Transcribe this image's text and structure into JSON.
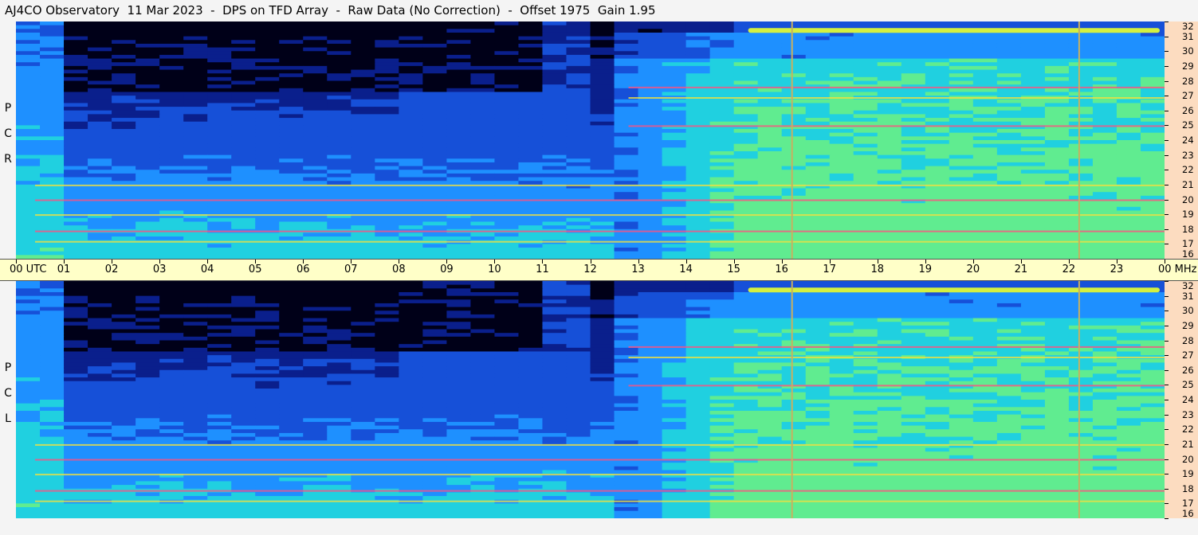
{
  "title": "AJ4CO Observatory  11 Mar 2023  -  DPS on TFD Array  -  Raw Data (No Correction)  -  Offset 1975  Gain 1.95",
  "chart_data": {
    "type": "heatmap",
    "title": "AJ4CO Observatory  11 Mar 2023  -  DPS on TFD Array  -  Raw Data (No Correction)  -  Offset 1975  Gain 1.95",
    "x_axis": {
      "label": "UTC",
      "range": [
        0,
        24
      ],
      "tick_labels": [
        "00",
        "01",
        "02",
        "03",
        "04",
        "05",
        "06",
        "07",
        "08",
        "09",
        "10",
        "11",
        "12",
        "13",
        "14",
        "15",
        "16",
        "17",
        "18",
        "19",
        "20",
        "21",
        "22",
        "23",
        "00"
      ],
      "first_extra": "UTC",
      "last_extra": "MHz"
    },
    "y_axis": {
      "label": "MHz",
      "range": [
        16,
        32
      ],
      "tick_labels": [
        "32",
        "31",
        "30",
        "29",
        "28",
        "27",
        "26",
        "25",
        "24",
        "23",
        "22",
        "21",
        "20",
        "19",
        "18",
        "17",
        "16"
      ]
    },
    "panels": [
      {
        "name": "R C P",
        "letters": [
          "P",
          "C",
          "R"
        ]
      },
      {
        "name": "L C P",
        "letters": [
          "P",
          "C",
          "L"
        ]
      }
    ],
    "colormap": [
      "#000018",
      "#0a1f8c",
      "#1650d8",
      "#1e90ff",
      "#20d0e0",
      "#60ec90",
      "#d4f040",
      "#ff9030",
      "#ff3070"
    ],
    "features": {
      "night_minimum_hours": [
        1,
        12.5
      ],
      "daytime_bright_hours": [
        12.5,
        24
      ],
      "vertical_lines_hours": [
        16.2,
        22.2
      ],
      "band_31_mhz_hours": [
        15.3,
        23.9
      ],
      "strong_bands_mhz": [
        17.2,
        17.9,
        19.0,
        20.0,
        21.0,
        25.0,
        26.9,
        27.6
      ]
    }
  }
}
